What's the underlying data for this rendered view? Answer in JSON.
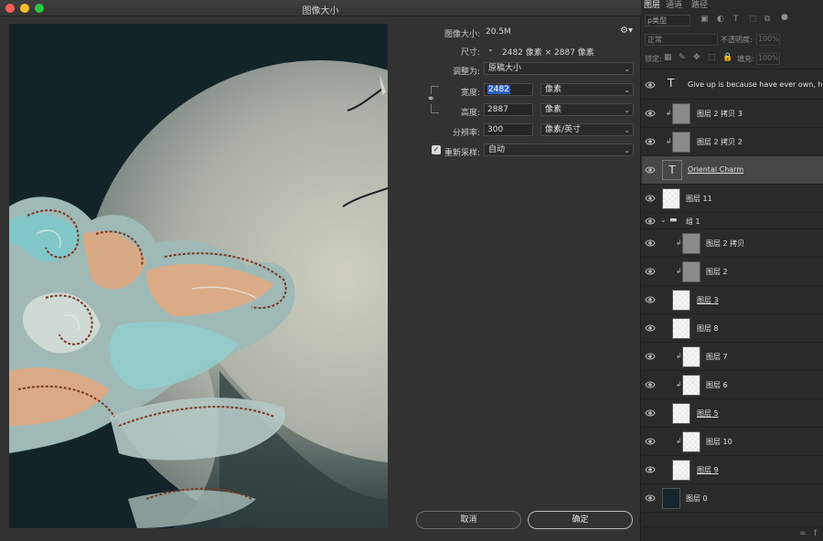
{
  "dialog": {
    "title": "图像大小",
    "image_size_label": "图像大小:",
    "image_size_value": "20.5M",
    "dimensions_label": "尺寸:",
    "dimensions_value": "2482 像素  ×  2887 像素",
    "fit_to_label": "调整为:",
    "fit_to_value": "原稿大小",
    "width_label": "宽度:",
    "width_value": "2482",
    "width_unit": "像素",
    "height_label": "高度:",
    "height_value": "2887",
    "height_unit": "像素",
    "resolution_label": "分辨率:",
    "resolution_value": "300",
    "resolution_unit": "像素/英寸",
    "resample_label": "重新采样:",
    "resample_value": "自动",
    "cancel_label": "取消",
    "ok_label": "确定"
  },
  "panel": {
    "tabs": [
      "图层",
      "通道",
      "路径"
    ],
    "filter_kind": "ρ类型",
    "blend_mode": "正常",
    "opacity_label": "不透明度:",
    "opacity_value": "100%",
    "lock_label": "锁定:",
    "fill_label": "填充:",
    "fill_value": "100%",
    "layers": [
      {
        "name": "Give up is because have ever own, hap",
        "type": "text"
      },
      {
        "name": "图层 2 拷贝 3",
        "type": "image"
      },
      {
        "name": "图层 2 拷贝 2",
        "type": "image"
      },
      {
        "name": "Oriental Charm",
        "type": "text"
      },
      {
        "name": "图层 11",
        "type": "image"
      },
      {
        "name": "组 1",
        "type": "group"
      },
      {
        "name": "图层 2 拷贝",
        "type": "image"
      },
      {
        "name": "图层 2",
        "type": "image"
      },
      {
        "name": "图层 3",
        "type": "image"
      },
      {
        "name": "图层 8",
        "type": "image"
      },
      {
        "name": "图层 7",
        "type": "image"
      },
      {
        "name": "图层 6",
        "type": "image"
      },
      {
        "name": "图层 5",
        "type": "image"
      },
      {
        "name": "图层 10",
        "type": "image"
      },
      {
        "name": "图层 9",
        "type": "image"
      },
      {
        "name": "图层 0",
        "type": "image"
      }
    ]
  },
  "colors": {
    "dialog_bg": "#323232",
    "panel_bg": "#2a2a2a",
    "selection": "#2f64c4",
    "close_red": "#fc5f57",
    "minimize_yellow": "#fdbc2e",
    "zoom_green": "#28c940"
  }
}
